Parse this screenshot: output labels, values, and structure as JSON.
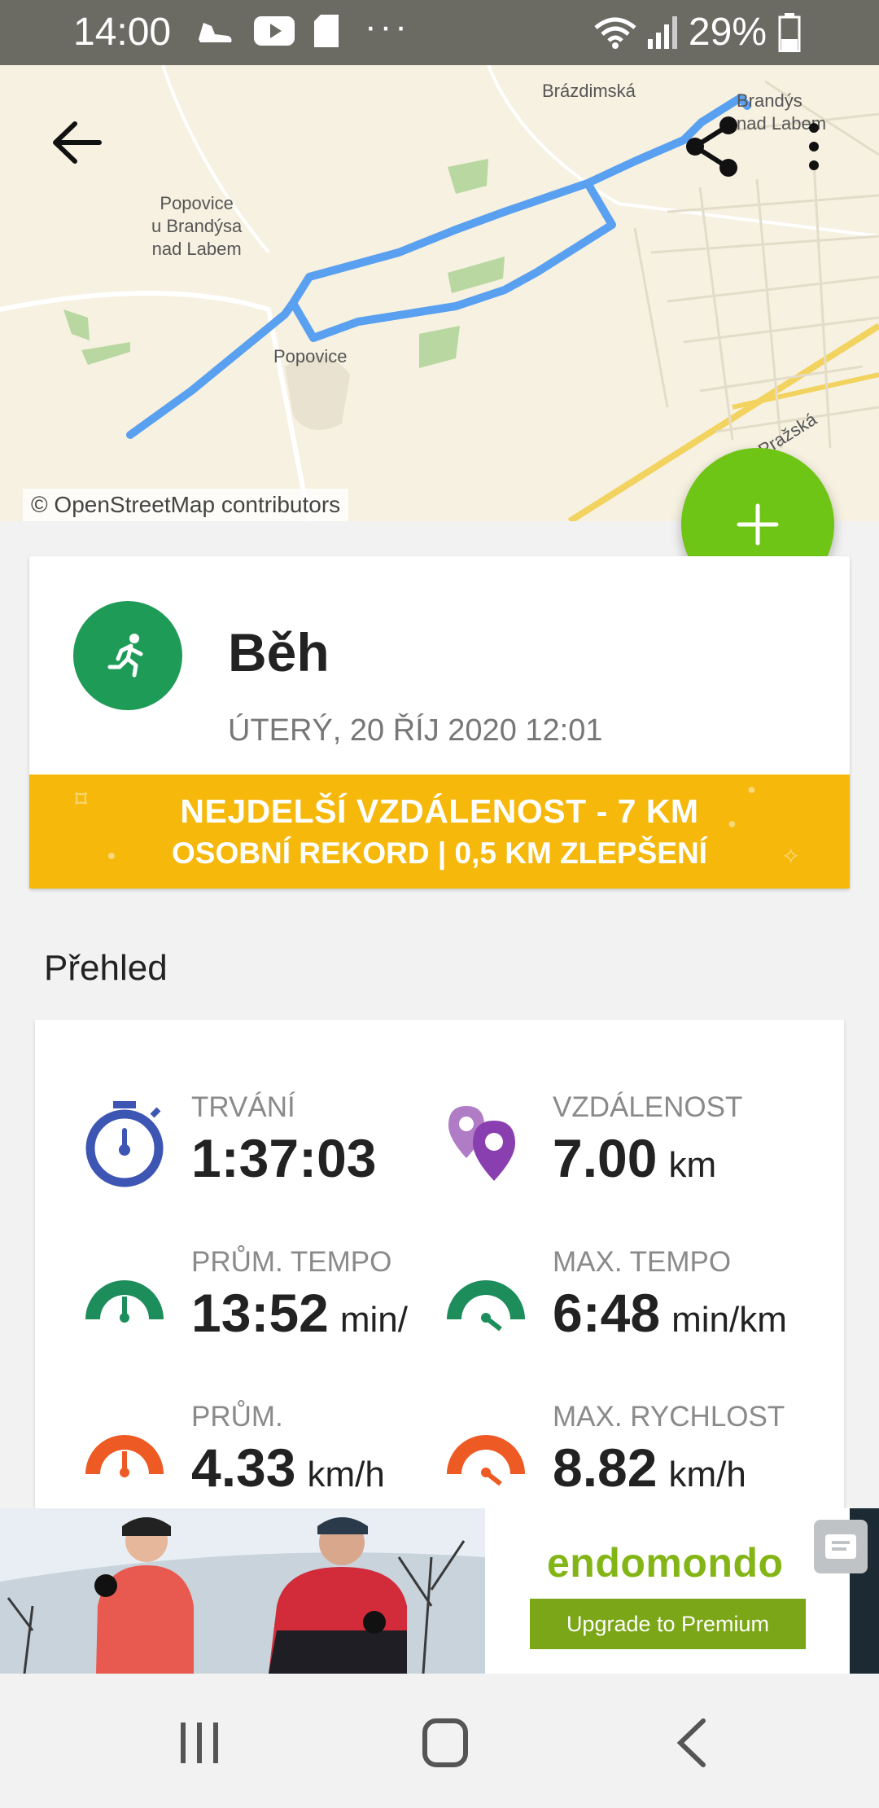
{
  "status_bar": {
    "time": "14:00",
    "battery": "29%",
    "more": "···",
    "icons": [
      "shoe-icon",
      "youtube-icon",
      "sd-card-icon",
      "wifi-icon",
      "signal-icon",
      "battery-icon"
    ]
  },
  "map": {
    "attribution": "© OpenStreetMap contributors",
    "places": [
      "Popovice\nu Brandýsa\nnad Labem",
      "Popovice",
      "Brázdimská",
      "Brandýs\nnad Labem",
      "Pražská"
    ]
  },
  "workout": {
    "sport": "Běh",
    "date": "ÚTERÝ, 20 ŘÍJ 2020 12:01",
    "record_line1": "NEJDELŠÍ VZDÁLENOST  -  7 KM",
    "record_line2": "OSOBNÍ REKORD  |  0,5 KM ZLEPŠENÍ"
  },
  "overview": {
    "title": "Přehled",
    "stats": [
      {
        "label": "TRVÁNÍ",
        "value": "1:37:03",
        "unit": ""
      },
      {
        "label": "VZDÁLENOST",
        "value": "7.00",
        "unit": "km"
      },
      {
        "label": "PRŮM. TEMPO",
        "value": "13:52",
        "unit": "min/"
      },
      {
        "label": "MAX. TEMPO",
        "value": "6:48",
        "unit": "min/km"
      },
      {
        "label": "PRŮM.",
        "value": "4.33",
        "unit": "km/h"
      },
      {
        "label": "MAX. RYCHLOST",
        "value": "8.82",
        "unit": "km/h"
      }
    ]
  },
  "ad": {
    "brand": "endomondo",
    "cta": "Upgrade to Premium"
  },
  "colors": {
    "accent_green": "#6fc515",
    "sport_green": "#1f9b58",
    "record_yellow": "#f5b80b",
    "route_blue": "#5aa0f0",
    "stopwatch_blue": "#3d56b3",
    "pin_purple": "#8a3fb0",
    "gauge_green": "#1e8d5c",
    "gauge_orange": "#ee5a24"
  }
}
